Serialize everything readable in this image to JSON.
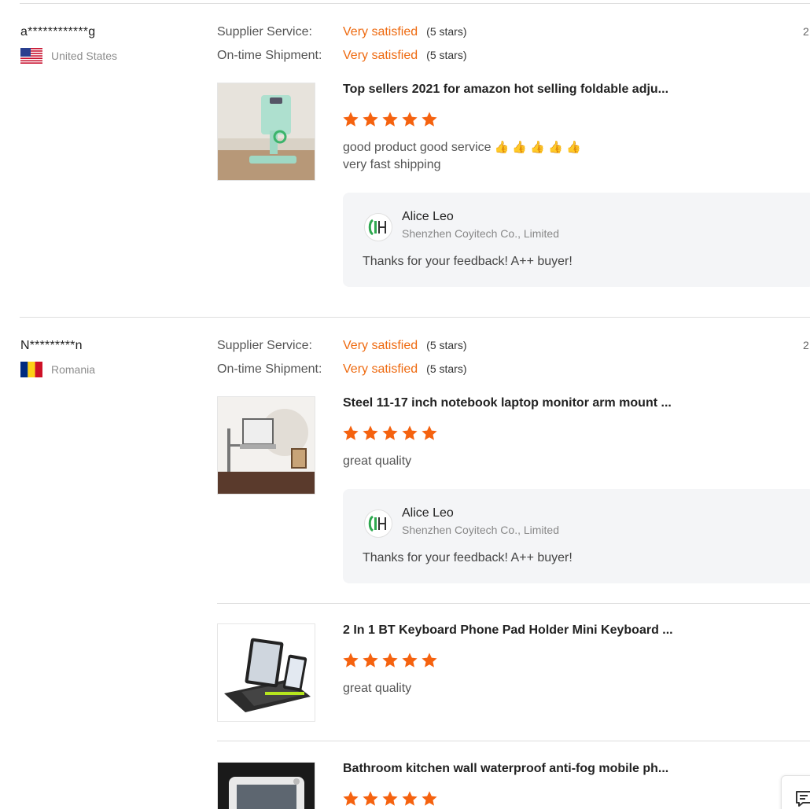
{
  "reviews": [
    {
      "buyer": "a************g",
      "country": "United States",
      "date_fragment": "2",
      "ratings": [
        {
          "label": "Supplier Service:",
          "value": "Very satisfied",
          "stars": "(5 stars)"
        },
        {
          "label": "On-time Shipment:",
          "value": "Very satisfied",
          "stars": "(5 stars)"
        }
      ],
      "products": [
        {
          "title": "Top sellers 2021 for amazon hot selling foldable adju...",
          "rating": 5,
          "comment_line1": "good product good service",
          "comment_emoji": "👍 👍 👍 👍 👍",
          "comment_line2": "very fast shipping"
        }
      ],
      "reply": {
        "name": "Alice Leo",
        "company": "Shenzhen Coyitech Co., Limited",
        "text": "Thanks for your feedback! A++ buyer!"
      }
    },
    {
      "buyer": "N*********n",
      "country": "Romania",
      "date_fragment": "2",
      "ratings": [
        {
          "label": "Supplier Service:",
          "value": "Very satisfied",
          "stars": "(5 stars)"
        },
        {
          "label": "On-time Shipment:",
          "value": "Very satisfied",
          "stars": "(5 stars)"
        }
      ],
      "products": [
        {
          "title": "Steel 11-17 inch notebook laptop monitor arm mount ...",
          "rating": 5,
          "comment_line1": "great quality"
        },
        {
          "title": "2 In 1 BT Keyboard Phone Pad Holder Mini Keyboard ...",
          "rating": 5,
          "comment_line1": "great quality"
        },
        {
          "title": "Bathroom kitchen wall waterproof anti-fog mobile ph...",
          "rating": 5
        }
      ],
      "reply": {
        "name": "Alice Leo",
        "company": "Shenzhen Coyitech Co., Limited",
        "text": "Thanks for your feedback! A++ buyer!"
      }
    }
  ],
  "colors": {
    "accent": "#ee6a10",
    "star": "#f5620f",
    "reply_bg": "#f4f5f7"
  },
  "icons": {
    "chat": "chat-icon",
    "star": "star-icon",
    "supplier_logo": "supplier-logo-icon"
  }
}
